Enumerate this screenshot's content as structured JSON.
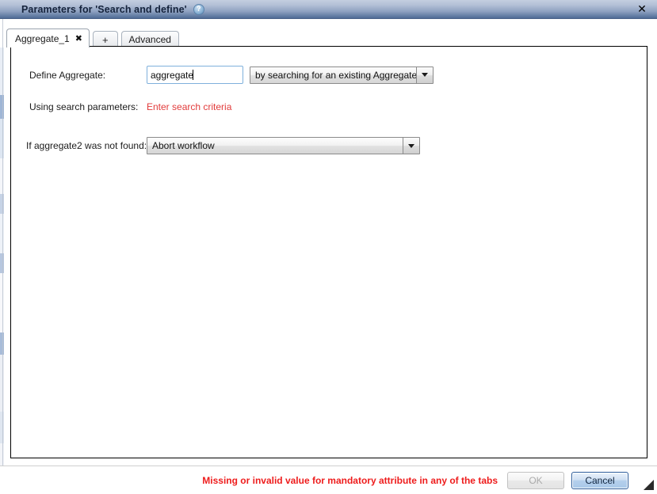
{
  "window": {
    "title": "Parameters for 'Search and define'",
    "help_icon": "question-mark-icon",
    "close_label": "✕"
  },
  "tabs": [
    {
      "label": "Aggregate_1",
      "close": "✖",
      "active": true
    },
    {
      "label": "+",
      "active": false
    },
    {
      "label": "Advanced",
      "active": false
    }
  ],
  "form": {
    "define_aggregate": {
      "label": "Define Aggregate:",
      "value": "aggregate",
      "placeholder": "",
      "mode": "by searching for an existing Aggregate"
    },
    "search_parameters": {
      "label": "Using search parameters:",
      "link": "Enter search criteria"
    },
    "not_found": {
      "label": "If aggregate2 was not found:",
      "value": "Abort workflow"
    }
  },
  "footer": {
    "error": "Missing or invalid value for mandatory attribute in any of the tabs",
    "ok_label": "OK",
    "cancel_label": "Cancel"
  },
  "colors": {
    "error_red": "#ee1c1c",
    "link_red": "#e23b3b",
    "title_bar_top": "#c3cee0",
    "title_bar_bottom": "#4e6b96",
    "focus_blue": "#7fb0dc",
    "cancel_border": "#2c5d9b"
  }
}
